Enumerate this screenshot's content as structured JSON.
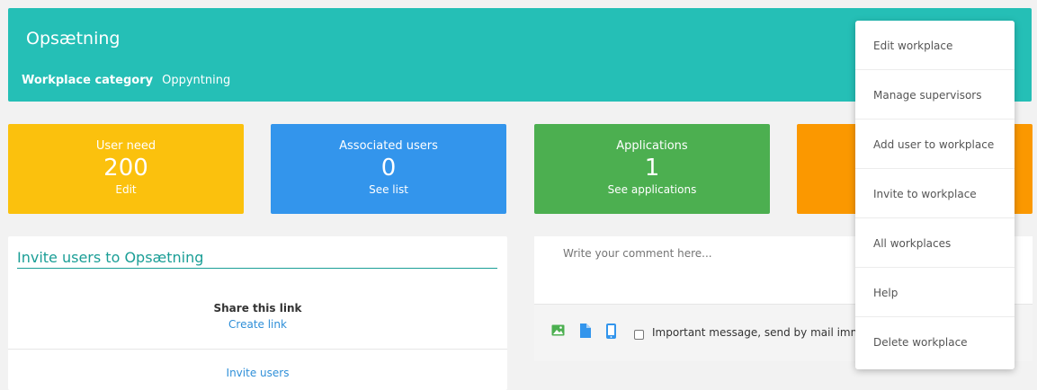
{
  "header": {
    "title": "Opsætning",
    "category_label": "Workplace category",
    "category_value": "Oppyntning"
  },
  "stats": [
    {
      "label": "User need",
      "value": "200",
      "link": "Edit",
      "color": "#fbc10d"
    },
    {
      "label": "Associated users",
      "value": "0",
      "link": "See list",
      "color": "#3395ec"
    },
    {
      "label": "Applications",
      "value": "1",
      "link": "See applications",
      "color": "#4caf50"
    },
    {
      "color": "#fb9800"
    }
  ],
  "invite": {
    "title": "Invite users to Opsætning",
    "share_label": "Share this link",
    "create_link": "Create link",
    "invite_users": "Invite users"
  },
  "comment": {
    "placeholder": "Write your comment here...",
    "important_label": "Important message, send by mail imm",
    "icons": [
      "image-icon",
      "document-icon",
      "mobile-icon"
    ]
  },
  "menu": {
    "items": [
      "Edit workplace",
      "Manage supervisors",
      "Add user to workplace",
      "Invite to workplace",
      "All workplaces",
      "Help",
      "Delete workplace"
    ]
  },
  "colors": {
    "header": "#25bfb6",
    "accent_teal": "#1a9e96",
    "link_blue": "#2f8fd8"
  }
}
